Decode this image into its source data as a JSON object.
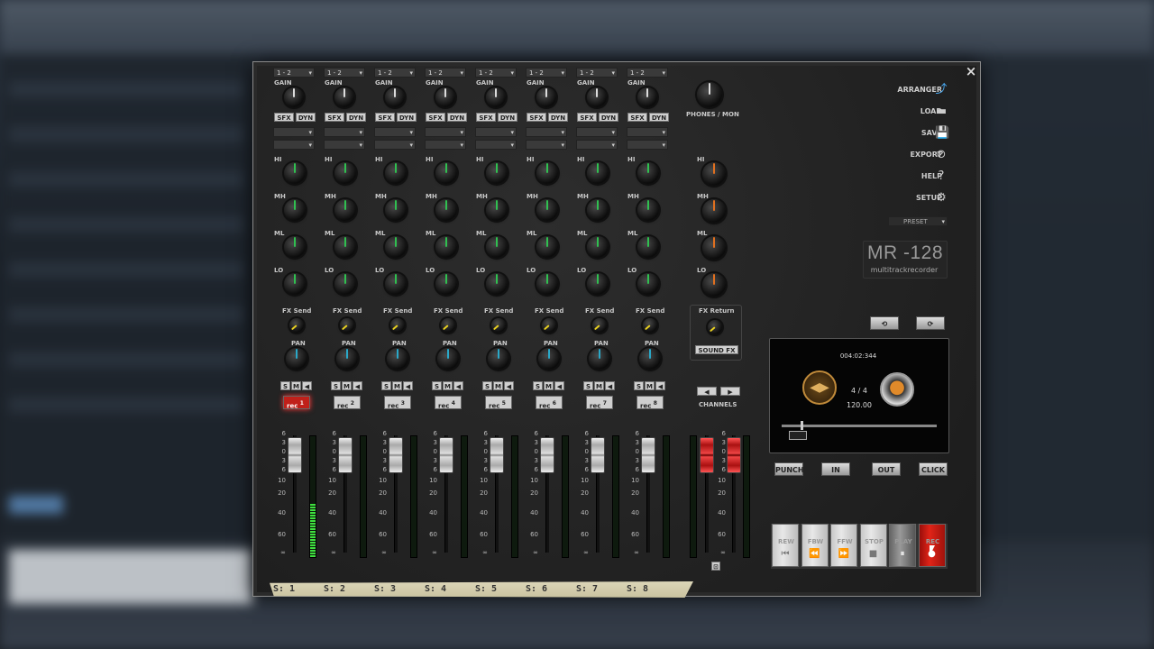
{
  "window": {
    "close_label": "×"
  },
  "channels": [
    {
      "input": "1 - 2",
      "rec_label": "rec",
      "rec_num": "1",
      "rec_on": true,
      "strip": "S: 1",
      "meter": 0.45
    },
    {
      "input": "1 - 2",
      "rec_label": "rec",
      "rec_num": "2",
      "rec_on": false,
      "strip": "S: 2",
      "meter": 0
    },
    {
      "input": "1 - 2",
      "rec_label": "rec",
      "rec_num": "3",
      "rec_on": false,
      "strip": "S: 3",
      "meter": 0
    },
    {
      "input": "1 - 2",
      "rec_label": "rec",
      "rec_num": "4",
      "rec_on": false,
      "strip": "S: 4",
      "meter": 0
    },
    {
      "input": "1 - 2",
      "rec_label": "rec",
      "rec_num": "5",
      "rec_on": false,
      "strip": "S: 5",
      "meter": 0
    },
    {
      "input": "1 - 2",
      "rec_label": "rec",
      "rec_num": "6",
      "rec_on": false,
      "strip": "S: 6",
      "meter": 0
    },
    {
      "input": "1 - 2",
      "rec_label": "rec",
      "rec_num": "7",
      "rec_on": false,
      "strip": "S: 7",
      "meter": 0
    },
    {
      "input": "1 - 2",
      "rec_label": "rec",
      "rec_num": "8",
      "rec_on": false,
      "strip": "S: 8",
      "meter": 0
    }
  ],
  "labels": {
    "gain": "GAIN",
    "sfx": "SFX",
    "dyn": "DYN",
    "hi": "HI",
    "mh": "MH",
    "ml": "ML",
    "lo": "LO",
    "fx_send": "FX Send",
    "pan": "PAN",
    "s": "S",
    "m": "M",
    "phones": "PHONES / MON",
    "fx_return": "FX Return",
    "sound_fx": "SOUND FX",
    "channels": "CHANNELS"
  },
  "scale_ticks": [
    "6",
    "3",
    "0",
    "3",
    "6",
    "10",
    "20",
    "40",
    "60",
    "∞"
  ],
  "menu": [
    {
      "label": "ARRANGER",
      "icon": "⤴"
    },
    {
      "label": "LOAD",
      "icon": "▬"
    },
    {
      "label": "SAVE",
      "icon": "💾"
    },
    {
      "label": "EXPORT",
      "icon": "⊘"
    },
    {
      "label": "HELP",
      "icon": "?"
    },
    {
      "label": "SETUP",
      "icon": "⚙"
    }
  ],
  "preset": {
    "label": "PRESET"
  },
  "logo": {
    "model": "MR -128",
    "subtitle": "multitrackrecorder"
  },
  "display": {
    "time": "004:02:344",
    "signature": "4 / 4",
    "tempo": "120.00",
    "position": 0.12
  },
  "punch": {
    "punch": "PUNCH",
    "in": "IN",
    "out": "OUT",
    "click": "CLICK"
  },
  "transport": {
    "rew": "REW",
    "fbw": "FBW",
    "ffw": "FFW",
    "stop": "STOP",
    "play": "PLAY",
    "rec": "REC"
  },
  "colors": {
    "rec_active": "#c0201a",
    "meter_green": "#3fe03f",
    "fx_knob": "#e8d020",
    "pan_knob": "#2aa8c8",
    "eq_knob": "#30c050",
    "master_eq": "#e07020"
  }
}
